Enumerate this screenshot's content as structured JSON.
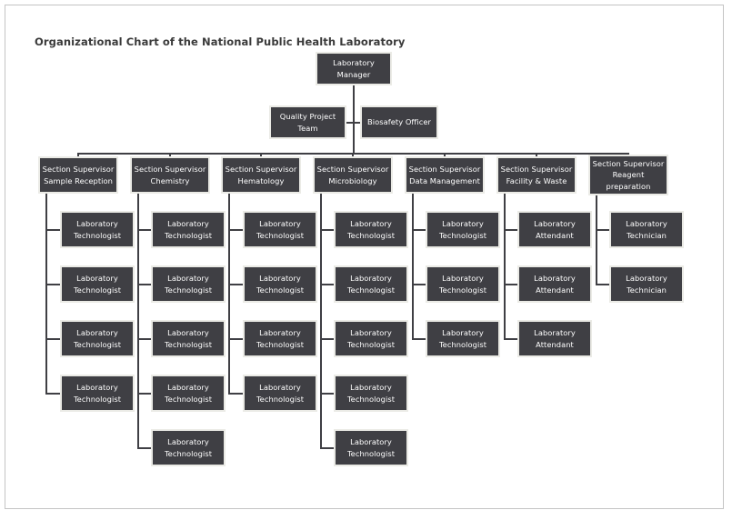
{
  "page": {
    "title": "Organizational Chart of the National Public Health Laboratory",
    "background_color": "#ffffff",
    "frame_color": "#c4c4c4"
  },
  "style": {
    "node_fill": "#3f3f44",
    "node_border": "#ebebe6",
    "node_text": "#ffffff",
    "connector_color": "#3f3f44",
    "title_color": "#3a3a3a"
  },
  "chart_data": {
    "type": "diagram",
    "subtype": "organizational-chart",
    "title": "Organizational Chart of the National Public Health Laboratory",
    "orientation": "top-down",
    "root": {
      "id": "lab-manager",
      "label": "Laboratory Manager",
      "lines": [
        "Laboratory",
        "Manager"
      ]
    },
    "staff_units": [
      {
        "id": "quality-project-team",
        "label": "Quality Project Team",
        "lines": [
          "Quality Project",
          "Team"
        ],
        "side": "left",
        "reports_to": "lab-manager"
      },
      {
        "id": "biosafety-officer",
        "label": "Biosafety Officer",
        "lines": [
          "Biosafety Officer"
        ],
        "side": "right",
        "reports_to": "lab-manager"
      }
    ],
    "sections": [
      {
        "id": "section-sample-reception",
        "label": "Section Supervisor Sample Reception",
        "lines": [
          "Section Supervisor",
          "Sample Reception"
        ],
        "reports_to": "lab-manager",
        "reports_count": 4,
        "reports": [
          {
            "label": "Laboratory Technologist",
            "lines": [
              "Laboratory",
              "Technologist"
            ]
          },
          {
            "label": "Laboratory Technologist",
            "lines": [
              "Laboratory",
              "Technologist"
            ]
          },
          {
            "label": "Laboratory Technologist",
            "lines": [
              "Laboratory",
              "Technologist"
            ]
          },
          {
            "label": "Laboratory Technologist",
            "lines": [
              "Laboratory",
              "Technologist"
            ]
          }
        ]
      },
      {
        "id": "section-chemistry",
        "label": "Section Supervisor Chemistry",
        "lines": [
          "Section Supervisor",
          "Chemistry"
        ],
        "reports_to": "lab-manager",
        "reports_count": 5,
        "reports": [
          {
            "label": "Laboratory Technologist",
            "lines": [
              "Laboratory",
              "Technologist"
            ]
          },
          {
            "label": "Laboratory Technologist",
            "lines": [
              "Laboratory",
              "Technologist"
            ]
          },
          {
            "label": "Laboratory Technologist",
            "lines": [
              "Laboratory",
              "Technologist"
            ]
          },
          {
            "label": "Laboratory Technologist",
            "lines": [
              "Laboratory",
              "Technologist"
            ]
          },
          {
            "label": "Laboratory Technologist",
            "lines": [
              "Laboratory",
              "Technologist"
            ]
          }
        ]
      },
      {
        "id": "section-hematology",
        "label": "Section Supervisor Hematology",
        "lines": [
          "Section Supervisor",
          "Hematology"
        ],
        "reports_to": "lab-manager",
        "reports_count": 4,
        "reports": [
          {
            "label": "Laboratory Technologist",
            "lines": [
              "Laboratory",
              "Technologist"
            ]
          },
          {
            "label": "Laboratory Technologist",
            "lines": [
              "Laboratory",
              "Technologist"
            ]
          },
          {
            "label": "Laboratory Technologist",
            "lines": [
              "Laboratory",
              "Technologist"
            ]
          },
          {
            "label": "Laboratory Technologist",
            "lines": [
              "Laboratory",
              "Technologist"
            ]
          }
        ]
      },
      {
        "id": "section-microbiology",
        "label": "Section Supervisor Microbiology",
        "lines": [
          "Section Supervisor",
          "Microbiology"
        ],
        "reports_to": "lab-manager",
        "reports_count": 5,
        "reports": [
          {
            "label": "Laboratory Technologist",
            "lines": [
              "Laboratory",
              "Technologist"
            ]
          },
          {
            "label": "Laboratory Technologist",
            "lines": [
              "Laboratory",
              "Technologist"
            ]
          },
          {
            "label": "Laboratory Technologist",
            "lines": [
              "Laboratory",
              "Technologist"
            ]
          },
          {
            "label": "Laboratory Technologist",
            "lines": [
              "Laboratory",
              "Technologist"
            ]
          },
          {
            "label": "Laboratory Technologist",
            "lines": [
              "Laboratory",
              "Technologist"
            ]
          }
        ]
      },
      {
        "id": "section-data-management",
        "label": "Section Supervisor Data Management",
        "lines": [
          "Section Supervisor",
          "Data Management"
        ],
        "reports_to": "lab-manager",
        "reports_count": 3,
        "reports": [
          {
            "label": "Laboratory Technologist",
            "lines": [
              "Laboratory",
              "Technologist"
            ]
          },
          {
            "label": "Laboratory Technologist",
            "lines": [
              "Laboratory",
              "Technologist"
            ]
          },
          {
            "label": "Laboratory Technologist",
            "lines": [
              "Laboratory",
              "Technologist"
            ]
          }
        ]
      },
      {
        "id": "section-facility-waste",
        "label": "Section Supervisor Facility & Waste",
        "lines": [
          "Section Supervisor",
          "Facility & Waste"
        ],
        "reports_to": "lab-manager",
        "reports_count": 3,
        "reports": [
          {
            "label": "Laboratory Attendant",
            "lines": [
              "Laboratory",
              "Attendant"
            ]
          },
          {
            "label": "Laboratory Attendant",
            "lines": [
              "Laboratory",
              "Attendant"
            ]
          },
          {
            "label": "Laboratory Attendant",
            "lines": [
              "Laboratory",
              "Attendant"
            ]
          }
        ]
      },
      {
        "id": "section-reagent-preparation",
        "label": "Section Supervisor Reagent preparation",
        "lines": [
          "Section Supervisor",
          "Reagent",
          "preparation"
        ],
        "reports_to": "lab-manager",
        "reports_count": 2,
        "reports": [
          {
            "label": "Laboratory Technician",
            "lines": [
              "Laboratory",
              "Technician"
            ]
          },
          {
            "label": "Laboratory Technician",
            "lines": [
              "Laboratory",
              "Technician"
            ]
          }
        ]
      }
    ],
    "totals": {
      "sections": 7,
      "staff_units": 2,
      "leaf_nodes": 26
    }
  }
}
